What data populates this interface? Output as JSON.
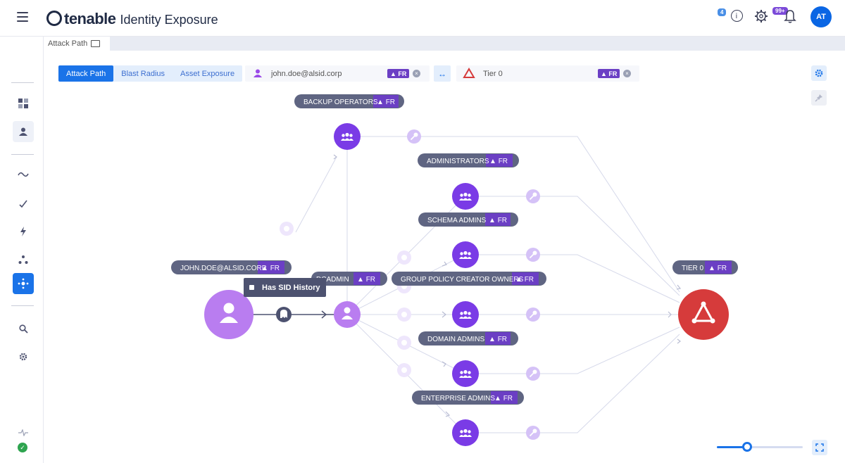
{
  "app": {
    "brand": "tenable",
    "product": "Identity Exposure",
    "notification_count": "4",
    "alert_count": "99+",
    "user_initials": "AT"
  },
  "tabs": {
    "active": "Attack Path"
  },
  "toolbar": {
    "modes": [
      "Attack Path",
      "Blast Radius",
      "Asset Exposure"
    ],
    "active_mode": "Attack Path",
    "source": {
      "value": "john.doe@alsid.corp",
      "tag": "FR"
    },
    "target": {
      "value": "Tier 0",
      "tag": "FR"
    }
  },
  "graph": {
    "source_label": "JOHN.DOE@ALSID.CORP",
    "target_label": "TIER 0",
    "tag": "FR",
    "middle_label": "DCADMIN",
    "groups": [
      "BACKUP OPERATORS",
      "ADMINISTRATORS",
      "SCHEMA ADMINS",
      "GROUP POLICY CREATOR OWNERS",
      "DOMAIN ADMINS",
      "ENTERPRISE ADMINS"
    ],
    "tooltip": "Has SID History"
  },
  "zoom": {
    "level": 0.35
  },
  "colors": {
    "primary": "#1a73e8",
    "node_purple": "#7a3be6",
    "node_light_purple": "#b97df0",
    "tier0_red": "#d63b3b",
    "pill_bg": "#5f6582",
    "tag_purple": "#6b3fc4"
  },
  "icons": [
    "menu-icon",
    "info-icon",
    "gear-icon",
    "bell-icon",
    "book-icon",
    "user-icon",
    "group-icon",
    "key-icon",
    "ghost-icon",
    "tier0-icon",
    "pin-icon",
    "fullscreen-icon",
    "lock-icon"
  ]
}
